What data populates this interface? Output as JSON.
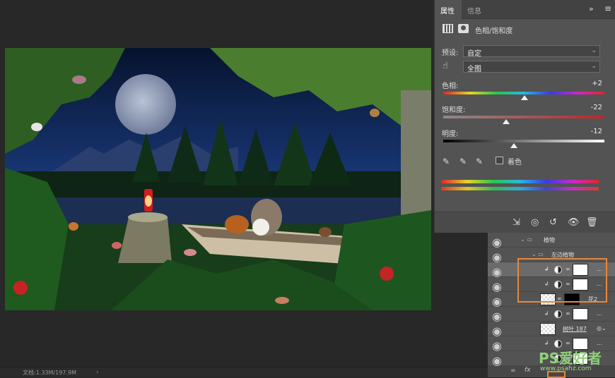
{
  "status": {
    "doc_info": "文档:1.33M/197.9M",
    "arrow": "›"
  },
  "properties": {
    "tabs": [
      "属性",
      "信息"
    ],
    "menu_glyph": "≡",
    "collapse_glyph": "»",
    "adjustment_title": "色相/饱和度",
    "preset_label": "预设:",
    "preset_value": "自定",
    "channel_value": "全图",
    "hue_label": "色相:",
    "hue_value": "+2",
    "hue_level": 0.505,
    "sat_label": "饱和度:",
    "sat_value": "-22",
    "sat_level": 0.39,
    "light_label": "明度:",
    "light_value": "-12",
    "light_level": 0.44,
    "colorize_label": "着色"
  },
  "layers": {
    "group1": "植物",
    "group2": "左边植物",
    "layer_flower": "花2",
    "layer_leaf": "树叶 187",
    "more": "...",
    "fx": "fx"
  },
  "watermark": {
    "brand": "PS爱好者",
    "site": "www.psahz.com"
  }
}
